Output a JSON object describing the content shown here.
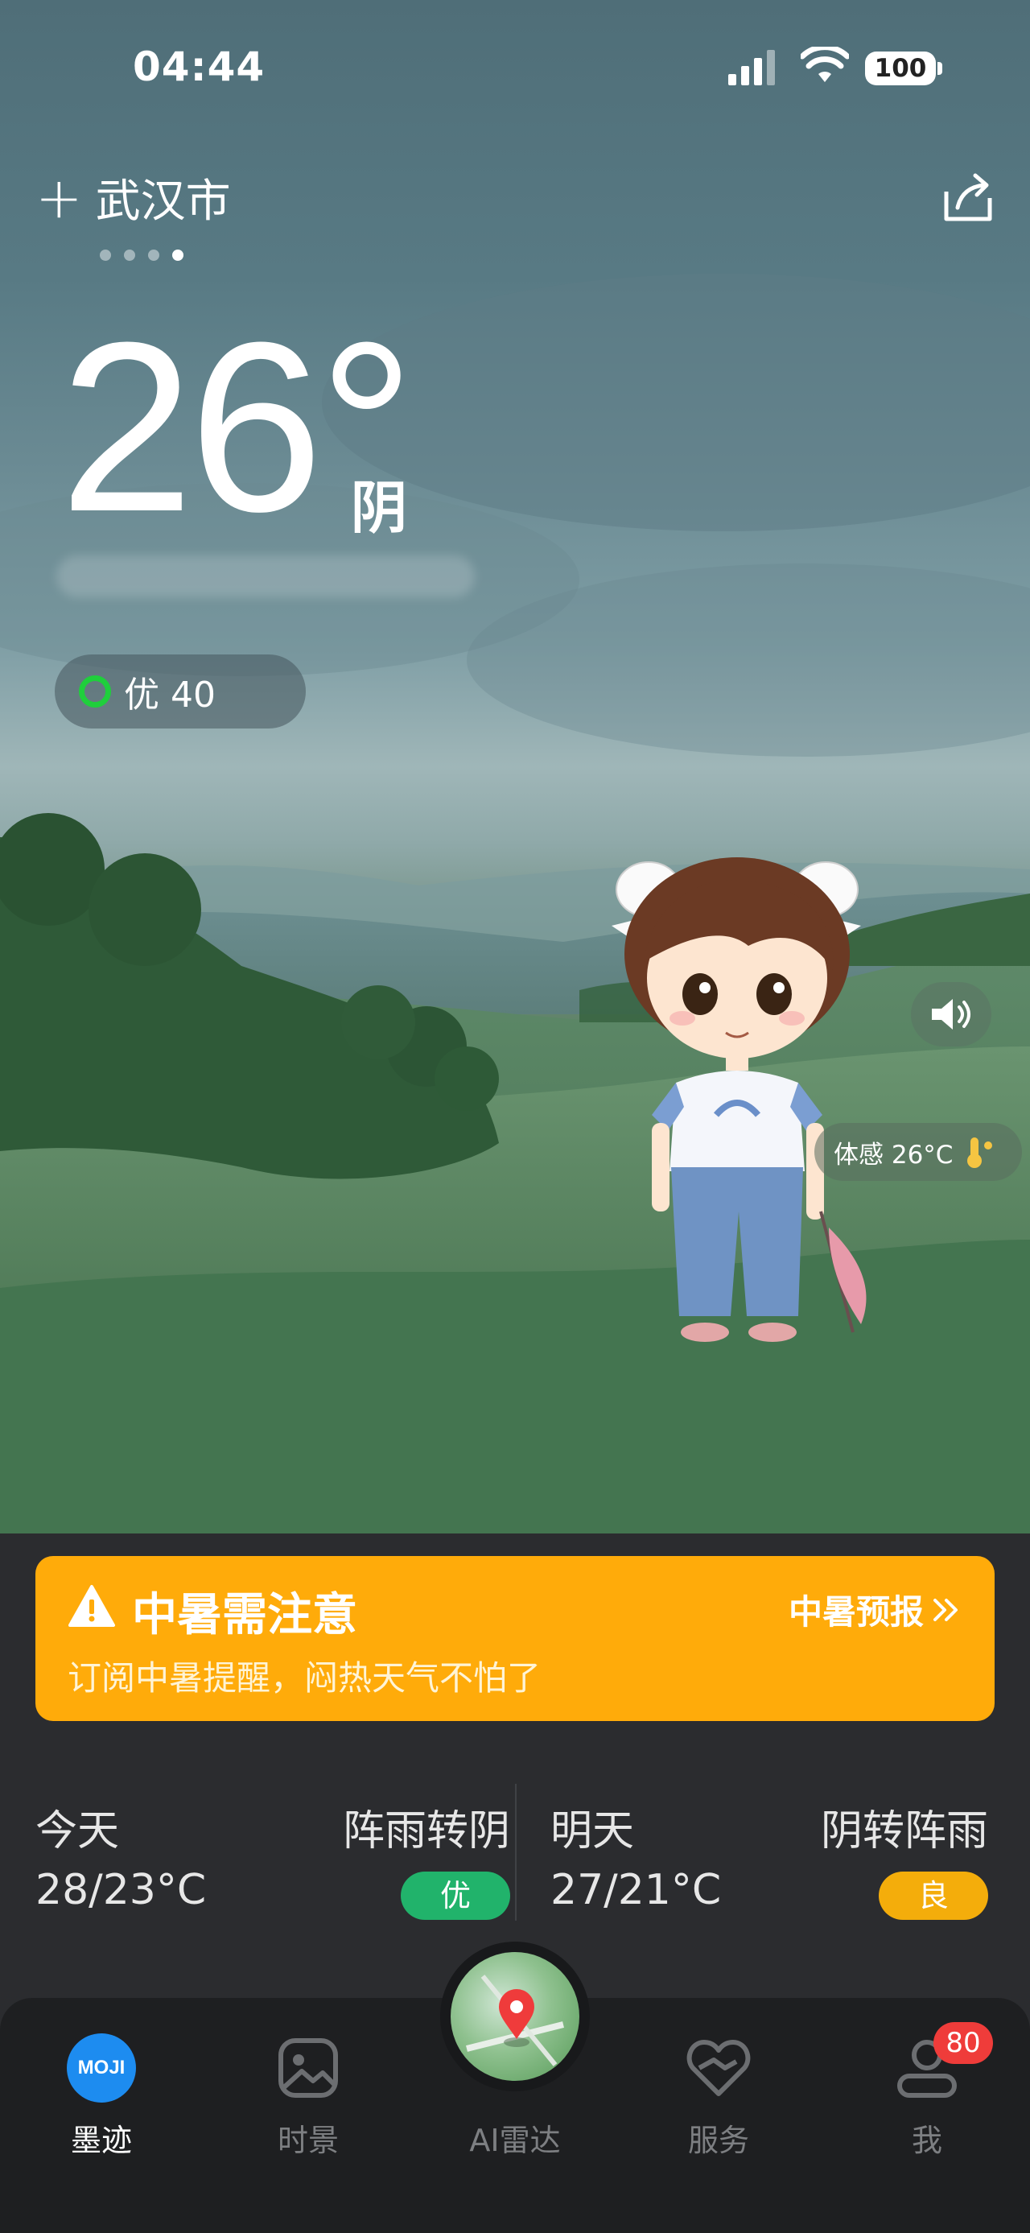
{
  "status_bar": {
    "time": "04:44",
    "battery": "100"
  },
  "header": {
    "city": "武汉市",
    "plus": "+"
  },
  "weather": {
    "temperature": "26°",
    "condition": "阴",
    "aqi_label": "优 40",
    "feels_like": "体感 26°C"
  },
  "alert": {
    "title": "中暑需注意",
    "link": "中暑预报",
    "subtitle": "订阅中暑提醒，闷热天气不怕了"
  },
  "forecast": [
    {
      "day": "今天",
      "condition": "阵雨转阴",
      "range": "28/23°C",
      "aqi": "优",
      "aqi_color": "#21b36b"
    },
    {
      "day": "明天",
      "condition": "阴转阵雨",
      "range": "27/21°C",
      "aqi": "良",
      "aqi_color": "#f4ad0b"
    }
  ],
  "tabbar": {
    "tabs": [
      {
        "label": "墨迹",
        "icon": "moji-icon"
      },
      {
        "label": "时景",
        "icon": "photo-icon"
      },
      {
        "label": "AI雷达",
        "icon": "radar-icon"
      },
      {
        "label": "服务",
        "icon": "heart-hand-icon"
      },
      {
        "label": "我",
        "icon": "user-icon"
      }
    ],
    "moji_logo": "MOJI",
    "me_badge": "80"
  },
  "colors": {
    "alert_bg": "#ffab0a",
    "aqi_ring": "#1fcf3c",
    "badge_red": "#ef3c3a"
  }
}
